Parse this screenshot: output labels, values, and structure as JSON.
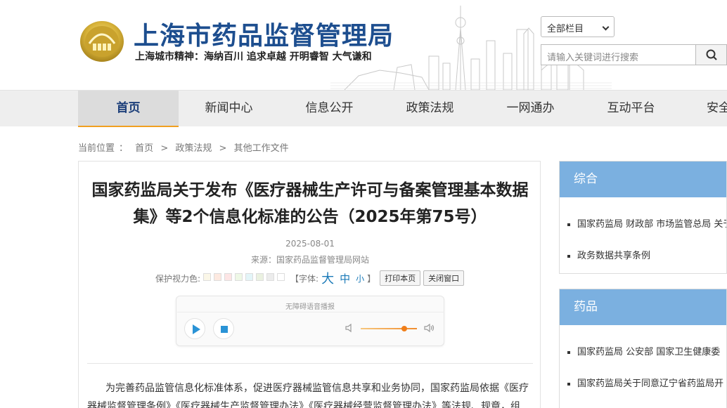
{
  "header": {
    "site_title": "上海市药品监督管理局",
    "slogan": "上海城市精神：海纳百川  追求卓越  开明睿智  大气谦和",
    "scope_select": "全部栏目",
    "search_placeholder": "请输入关键词进行搜索"
  },
  "nav": {
    "items": [
      "首页",
      "新闻中心",
      "信息公开",
      "政策法规",
      "一网通办",
      "互动平台",
      "安全"
    ],
    "active_index": 0
  },
  "breadcrumb": {
    "label": "当前位置",
    "separator": "：",
    "items": [
      "首页",
      "政策法规",
      "其他工作文件"
    ],
    "arrow": ">"
  },
  "article": {
    "title": "国家药监局关于发布《医疗器械生产许可与备案管理基本数据集》等2个信息化标准的公告（2025年第75号）",
    "date": "2025-08-01",
    "source": "来源：国家药品监督管理局网站",
    "tools": {
      "eye_protect_label": "保护视力色:",
      "swatch_colors": [
        "#fbf7e8",
        "#fde9e0",
        "#fde5e5",
        "#eef8e6",
        "#e3f5f8",
        "#eaf1e0",
        "#ececec",
        "#ffffff"
      ],
      "font_label": "【字体:",
      "font_large": "大",
      "font_medium": "中",
      "font_small": "小",
      "font_close": "】",
      "print_button": "打印本页",
      "close_button": "关闭窗口"
    },
    "player_label": "无障碍语音播报",
    "body": "为完善药品监管信息化标准体系，促进医疗器械监管信息共享和业务协同，国家药监局依据《医疗器械监督管理条例》《医疗器械生产监督管理办法》《医疗器械经营监督管理办法》等法规、规章，组"
  },
  "sidebar": {
    "panels": [
      {
        "title": "综合",
        "items": [
          "国家药监局 财政部 市场监管总局 关于",
          "政务数据共享条例"
        ]
      },
      {
        "title": "药品",
        "items": [
          "国家药监局 公安部 国家卫生健康委",
          "国家药监局关于同意辽宁省药监局开"
        ]
      }
    ]
  },
  "colors": {
    "brand_blue": "#1d4e8f",
    "nav_accent": "#f0a020",
    "panel_header": "#7bb0e0",
    "player_accent": "#f07e1a"
  }
}
